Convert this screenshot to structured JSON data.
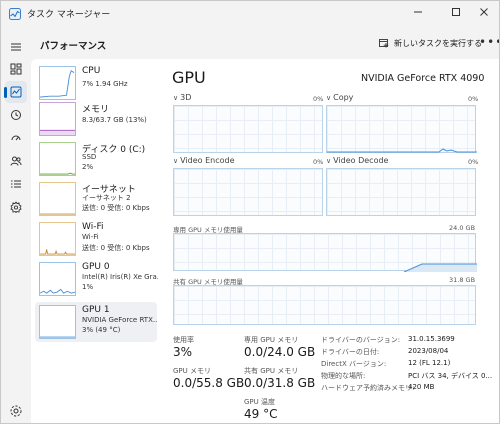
{
  "app": {
    "title": "タスク マネージャー"
  },
  "header": {
    "page_title": "パフォーマンス",
    "run_task_label": "新しいタスクを実行する",
    "more_label": "•••"
  },
  "nav": {
    "items": [
      "menu-icon",
      "processes-icon",
      "performance-icon",
      "history-icon",
      "startup-icon",
      "users-icon",
      "details-icon",
      "services-icon"
    ],
    "settings": "settings-icon"
  },
  "devices": [
    {
      "name": "CPU",
      "sub1": "7%  1.94 GHz",
      "sub2": ""
    },
    {
      "name": "メモリ",
      "sub1": "8.3/63.7 GB (13%)",
      "sub2": ""
    },
    {
      "name": "ディスク 0 (C:)",
      "sub1": "SSD",
      "sub2": "2%"
    },
    {
      "name": "イーサネット",
      "sub1": "イーサネット 2",
      "sub2": "送信: 0 受信: 0 Kbps"
    },
    {
      "name": "Wi-Fi",
      "sub1": "Wi-Fi",
      "sub2": "送信: 0 受信: 0 Kbps"
    },
    {
      "name": "GPU 0",
      "sub1": "Intel(R) Iris(R) Xe Gra...",
      "sub2": "1%"
    },
    {
      "name": "GPU 1",
      "sub1": "NVIDIA GeForce RTX...",
      "sub2": "3% (49 °C)"
    }
  ],
  "gpu": {
    "title": "GPU",
    "model": "NVIDIA GeForce RTX 4090",
    "engines": [
      {
        "label": "3D",
        "percent": "0%"
      },
      {
        "label": "Copy",
        "percent": "0%"
      },
      {
        "label": "Video Encode",
        "percent": "0%"
      },
      {
        "label": "Video Decode",
        "percent": "0%"
      }
    ],
    "dedicated_label": "専用 GPU メモリ使用量",
    "dedicated_max": "24.0 GB",
    "shared_label": "共有 GPU メモリ使用量",
    "shared_max": "31.8 GB"
  },
  "stats": {
    "utilization_label": "使用率",
    "utilization_value": "3%",
    "dedicated_mem_label": "専用 GPU メモリ",
    "dedicated_mem_value": "0.0/24.0 GB",
    "gpu_mem_label": "GPU メモリ",
    "gpu_mem_value": "0.0/55.8 GB",
    "shared_mem_label": "共有 GPU メモリ",
    "shared_mem_value": "0.0/31.8 GB",
    "temp_label": "GPU 温度",
    "temp_value": "49 °C"
  },
  "properties": [
    {
      "label": "ドライバーのバージョン:",
      "value": "31.0.15.3699"
    },
    {
      "label": "ドライバーの日付:",
      "value": "2023/08/04"
    },
    {
      "label": "DirectX バージョン:",
      "value": "12 (FL 12.1)"
    },
    {
      "label": "物理的な場所:",
      "value": "PCI バス 34, デバイス 0..."
    },
    {
      "label": "ハードウェア予約済みメモリ:",
      "value": "420 MB"
    }
  ],
  "colors": {
    "accent": "#005fb8",
    "gpu_line": "#4a90d9",
    "mem_line": "#a04cc0",
    "disk_line": "#5aa02c",
    "net_line": "#c88a2a"
  }
}
